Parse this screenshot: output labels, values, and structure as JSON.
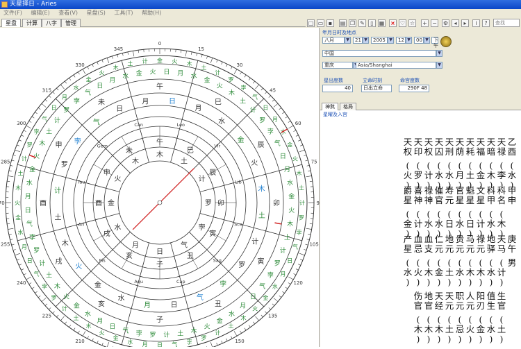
{
  "window": {
    "title": "天星择日 - Aries"
  },
  "menu": [
    "文件(F)",
    "编辑(E)",
    "查看(V)",
    "星盘(S)",
    "工具(T)",
    "帮助(H)"
  ],
  "tabs": [
    {
      "label": "星盘"
    },
    {
      "label": "计算"
    },
    {
      "label": "八字"
    },
    {
      "label": "管理"
    }
  ],
  "search": {
    "placeholder": "查找"
  },
  "panel": {
    "section_label": "年月日时及地点",
    "date": {
      "calendar": "八月",
      "day": "21",
      "year": "2005",
      "hour": "12",
      "minute": "00",
      "period": "下午"
    },
    "place": {
      "country": "中国",
      "city": "重庆",
      "timezone": "Asia/Shanghai"
    },
    "fields": [
      {
        "label": "星出度数",
        "value": "40"
      },
      {
        "label": "立命时刻",
        "value": "日出立命"
      },
      {
        "label": "命宫度数",
        "value": "290F 48"
      }
    ],
    "tabs": [
      {
        "label": "神煞"
      },
      {
        "label": "格局"
      }
    ],
    "sublink": "星曜及入宫"
  },
  "star_columns": [
    {
      "top": "乙酉",
      "a": "(水)"
    },
    {
      "top": "天禄",
      "a": "(李)"
    },
    {
      "top": "天暗",
      "a": "(木)"
    },
    {
      "top": "天福",
      "a": "(金)"
    },
    {
      "top": "天耗",
      "a": "(土)"
    },
    {
      "top": "天荫",
      "a": "(月)"
    },
    {
      "top": "天刑",
      "a": "(水)"
    },
    {
      "top": "天囚",
      "a": "(水)"
    },
    {
      "top": "天权",
      "a": "(计)"
    },
    {
      "top": "天印",
      "a": "(罗)"
    },
    {
      "top": "天权",
      "a": "(火)"
    }
  ],
  "star_rows2": [
    {
      "top": "甲申",
      "a": ""
    },
    {
      "top": "科名",
      "a": "(木)"
    },
    {
      "top": "科甲",
      "a": "(水)"
    },
    {
      "top": "文星",
      "a": "(计)"
    },
    {
      "top": "魁星",
      "a": "(日)"
    },
    {
      "top": "官星",
      "a": "(水)"
    },
    {
      "top": "寿元",
      "a": "(日)"
    },
    {
      "top": "催官",
      "a": "(水)"
    },
    {
      "top": "禄神",
      "a": "(水)"
    },
    {
      "top": "喜神",
      "a": "(计)"
    },
    {
      "top": "爵星",
      "a": "(金)"
    }
  ],
  "star_rows3": [
    {
      "top": "庚午",
      "a": "男"
    },
    {
      "top": "天马",
      "a": "(计)"
    },
    {
      "top": "地驿",
      "a": "(水)"
    },
    {
      "top": "禄元",
      "a": "(木)"
    },
    {
      "top": "马元",
      "a": "(木)"
    },
    {
      "top": "贵元",
      "a": "(水)"
    },
    {
      "top": "地元",
      "a": "(土)"
    },
    {
      "top": "仁元",
      "a": "(金)"
    },
    {
      "top": "血支",
      "a": "(木)"
    },
    {
      "top": "血忌",
      "a": "(火)"
    },
    {
      "top": "产星",
      "a": "(水)"
    }
  ],
  "star_rows4": [
    {
      "top": "生官",
      "a": "(土)"
    },
    {
      "top": "值生",
      "a": "(水)"
    },
    {
      "top": "阳刃",
      "a": "(金)"
    },
    {
      "top": "人元",
      "a": "(火)"
    },
    {
      "top": "职元",
      "a": "(忌)"
    },
    {
      "top": "天元",
      "a": "(土)"
    },
    {
      "top": "天经",
      "a": "(木)"
    },
    {
      "top": "地官",
      "a": "(木)"
    },
    {
      "top": "伤官",
      "a": "(木)"
    }
  ],
  "wheel": {
    "branches": [
      "子",
      "丑",
      "寅",
      "卯",
      "辰",
      "巳",
      "午",
      "未",
      "申",
      "酉",
      "戌",
      "亥"
    ],
    "planets": [
      "日",
      "月",
      "水",
      "金",
      "火",
      "木",
      "土",
      "计",
      "罗",
      "孛",
      "气"
    ],
    "signs": [
      "Leo",
      "Can",
      "Gem",
      "Tau",
      "Ari",
      "Pis",
      "Aqu",
      "Cap",
      "Sag",
      "Sco",
      "Lib",
      "Vir"
    ],
    "degree_labels": [
      "0",
      "15",
      "30",
      "45",
      "60",
      "75",
      "90",
      "105",
      "120",
      "135",
      "150",
      "165",
      "180",
      "195",
      "210",
      "225",
      "240",
      "255",
      "270",
      "285",
      "300",
      "315",
      "330",
      "345"
    ],
    "colors": {
      "green": "#2e8b3a",
      "blue": "#1e7fd0",
      "red": "#d02020",
      "dark": "#333333"
    }
  }
}
